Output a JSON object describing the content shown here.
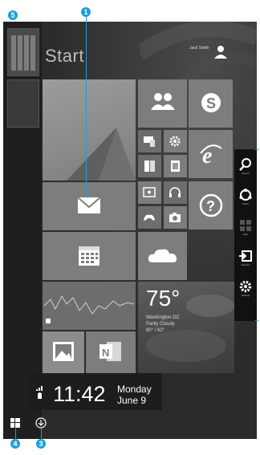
{
  "start_title": "Start",
  "callouts": [
    "1",
    "3",
    "4",
    "5"
  ],
  "clock": {
    "time": "11:42",
    "weekday": "Monday",
    "date": "June 9"
  },
  "weather": {
    "temp": "75°",
    "place": "Washington DC",
    "cond": "Partly Cloudy",
    "range": "80° / 62°"
  },
  "user": {
    "name": "Jack Smith"
  },
  "tile_labels": {
    "desktop": "Desktop",
    "mail": "Mail",
    "calendar": "Calendar",
    "finance": "Finance",
    "people": "People",
    "skype": "Skype",
    "ie": "Internet Explorer",
    "help": "Help+Tips",
    "onedrive": "OneDrive",
    "photos": "Photos",
    "onenote": "OneNote"
  },
  "charms": [
    {
      "label": "Search",
      "icon": "search-icon"
    },
    {
      "label": "Share",
      "icon": "share-icon"
    },
    {
      "label": "Start",
      "icon": "windows-icon"
    },
    {
      "label": "Devices",
      "icon": "devices-icon"
    },
    {
      "label": "Settings",
      "icon": "settings-icon"
    }
  ]
}
